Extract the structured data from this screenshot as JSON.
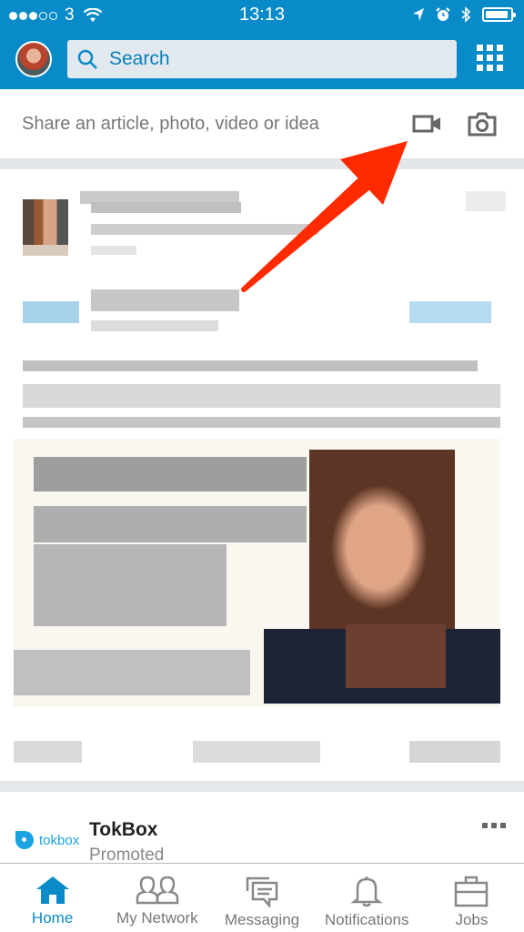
{
  "status_bar": {
    "signal_bars_filled": 3,
    "signal_bars_total": 5,
    "carrier": "3",
    "time": "13:13",
    "icons": [
      "location-icon",
      "alarm-icon",
      "bluetooth-icon",
      "battery-icon"
    ]
  },
  "header": {
    "avatar_icon": "profile-avatar",
    "search_placeholder": "Search",
    "search_value": "",
    "apps_icon": "grid-icon",
    "brand_color": "#0a8bc9"
  },
  "share_box": {
    "prompt": "Share an article, photo, video or idea",
    "video_icon": "video-camera-icon",
    "photo_icon": "camera-icon"
  },
  "annotation": {
    "type": "arrow",
    "color": "#ff2a00",
    "points_to": "video-camera-icon"
  },
  "feed_post": {
    "content": "pixelated / obscured post"
  },
  "promoted": {
    "logo_text": "tokbox",
    "name": "TokBox",
    "label": "Promoted",
    "logo_color": "#1ba3e1"
  },
  "bottom_nav": {
    "items": [
      {
        "label": "Home",
        "icon": "home-icon",
        "active": true
      },
      {
        "label": "My Network",
        "icon": "network-icon",
        "active": false
      },
      {
        "label": "Messaging",
        "icon": "messaging-icon",
        "active": false
      },
      {
        "label": "Notifications",
        "icon": "bell-icon",
        "active": false
      },
      {
        "label": "Jobs",
        "icon": "briefcase-icon",
        "active": false
      }
    ]
  }
}
